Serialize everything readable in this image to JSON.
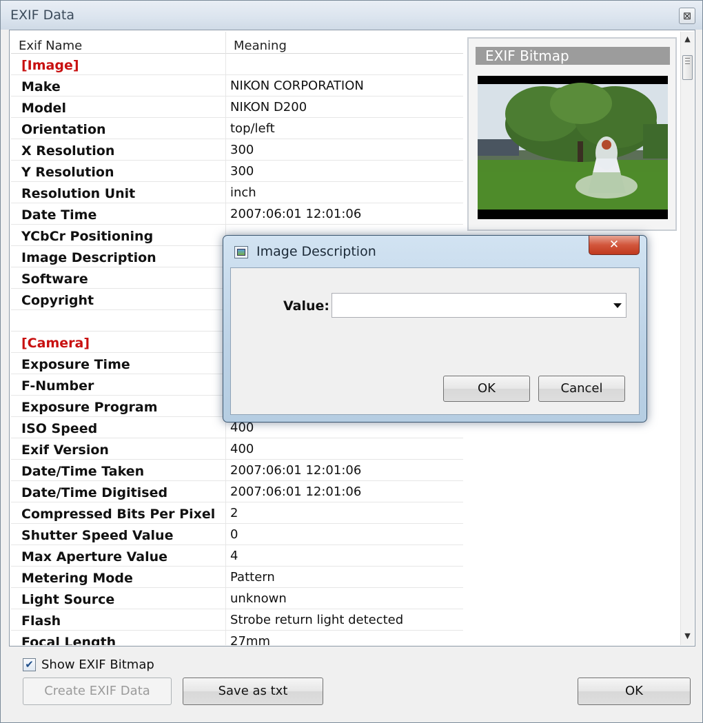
{
  "window": {
    "title": "EXIF Data",
    "close_glyph": "⊠"
  },
  "grid": {
    "columns": [
      "Exif Name",
      "Meaning"
    ],
    "rows": [
      {
        "name": "[Image]",
        "value": "",
        "section": true
      },
      {
        "name": "Make",
        "value": "NIKON CORPORATION"
      },
      {
        "name": "Model",
        "value": "NIKON D200"
      },
      {
        "name": "Orientation",
        "value": "top/left"
      },
      {
        "name": "X Resolution",
        "value": "300"
      },
      {
        "name": "Y Resolution",
        "value": "300"
      },
      {
        "name": "Resolution Unit",
        "value": "inch"
      },
      {
        "name": "Date Time",
        "value": "2007:06:01 12:01:06"
      },
      {
        "name": "YCbCr Positioning",
        "value": ""
      },
      {
        "name": "Image Description",
        "value": ""
      },
      {
        "name": "Software",
        "value": ""
      },
      {
        "name": "Copyright",
        "value": ""
      },
      {
        "name": "",
        "value": ""
      },
      {
        "name": "[Camera]",
        "value": "",
        "section": true
      },
      {
        "name": "Exposure Time",
        "value": ""
      },
      {
        "name": "F-Number",
        "value": ""
      },
      {
        "name": "Exposure Program",
        "value": ""
      },
      {
        "name": "ISO Speed",
        "value": "400"
      },
      {
        "name": "Exif Version",
        "value": "400"
      },
      {
        "name": "Date/Time Taken",
        "value": "2007:06:01 12:01:06"
      },
      {
        "name": "Date/Time Digitised",
        "value": "2007:06:01 12:01:06"
      },
      {
        "name": "Compressed Bits Per Pixel",
        "value": "2"
      },
      {
        "name": "Shutter Speed Value",
        "value": "0"
      },
      {
        "name": "Max Aperture Value",
        "value": "4"
      },
      {
        "name": "Metering Mode",
        "value": "Pattern"
      },
      {
        "name": "Light Source",
        "value": "unknown"
      },
      {
        "name": "Flash",
        "value": "Strobe return light detected"
      },
      {
        "name": "Focal Length",
        "value": "27mm"
      }
    ]
  },
  "bitmap": {
    "title": "EXIF Bitmap"
  },
  "footer": {
    "show_bitmap_label": "Show EXIF Bitmap",
    "show_bitmap_checked": true,
    "check_glyph": "✔",
    "create_label": "Create EXIF Data",
    "save_label": "Save as txt",
    "ok_label": "OK"
  },
  "dialog": {
    "title": "Image Description",
    "close_glyph": "✕",
    "value_label": "Value:",
    "value": "",
    "ok_label": "OK",
    "cancel_label": "Cancel"
  },
  "scrollbar": {
    "up_glyph": "▲",
    "down_glyph": "▼"
  }
}
